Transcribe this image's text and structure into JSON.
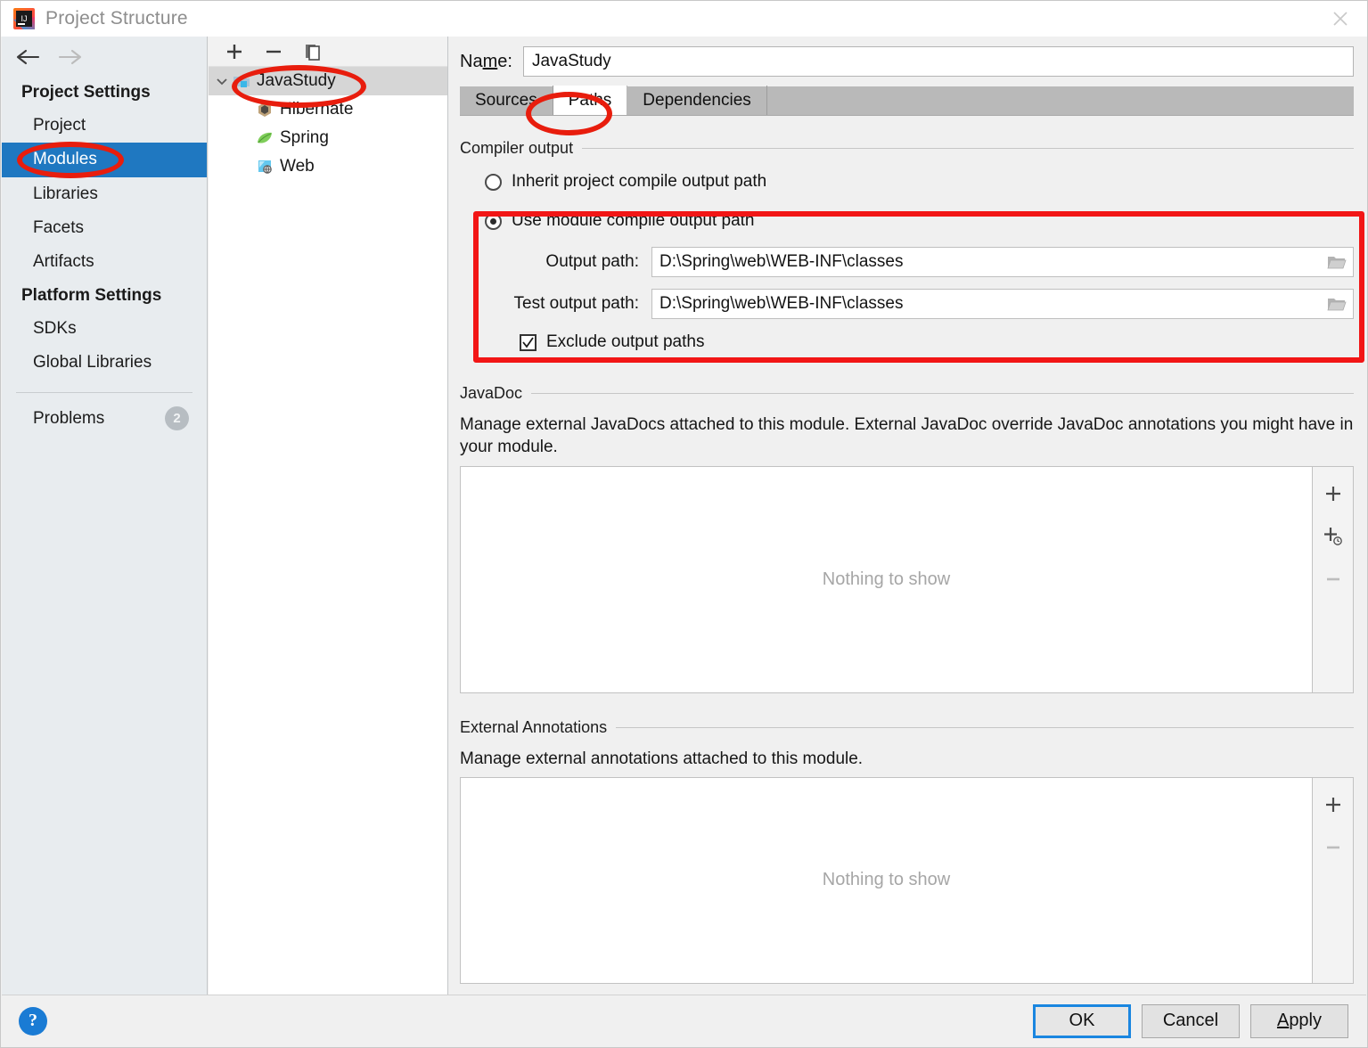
{
  "window": {
    "title": "Project Structure",
    "logo_icon": "intellij-idea-logo",
    "close_icon": "close-icon"
  },
  "sidebar": {
    "back_icon": "arrow-left-icon",
    "forward_icon": "arrow-right-icon",
    "groups": [
      {
        "header": "Project Settings",
        "items": [
          {
            "label": "Project",
            "selected": false
          },
          {
            "label": "Modules",
            "selected": true
          },
          {
            "label": "Libraries",
            "selected": false
          },
          {
            "label": "Facets",
            "selected": false
          },
          {
            "label": "Artifacts",
            "selected": false
          }
        ]
      },
      {
        "header": "Platform Settings",
        "items": [
          {
            "label": "SDKs",
            "selected": false
          },
          {
            "label": "Global Libraries",
            "selected": false
          }
        ]
      }
    ],
    "problems": {
      "label": "Problems",
      "count": "2"
    },
    "selected_color": "#1f78c1"
  },
  "tree": {
    "toolbar": {
      "add_icon": "plus-icon",
      "remove_icon": "minus-icon",
      "copy_icon": "copy-icon"
    },
    "nodes": [
      {
        "label": "JavaStudy",
        "icon": "module-folder-icon",
        "selected": true,
        "expanded": true,
        "depth": 0
      },
      {
        "label": "Hibernate",
        "icon": "hibernate-icon",
        "selected": false,
        "depth": 1
      },
      {
        "label": "Spring",
        "icon": "spring-leaf-icon",
        "selected": false,
        "depth": 1
      },
      {
        "label": "Web",
        "icon": "web-icon",
        "selected": false,
        "depth": 1
      }
    ]
  },
  "main": {
    "name_label_prefix": "Na",
    "name_label_mnemonic": "m",
    "name_label_suffix": "e:",
    "name_value": "JavaStudy",
    "tabs": [
      {
        "label": "Sources",
        "active": false
      },
      {
        "label": "Paths",
        "active": true
      },
      {
        "label": "Dependencies",
        "active": false
      }
    ],
    "compiler_output": {
      "group_title": "Compiler output",
      "inherit_option": "Inherit project compile output path",
      "inherit_selected": false,
      "module_option": "Use module compile output path",
      "module_selected": true,
      "output_path_label": "Output path:",
      "output_path_value": "D:\\Spring\\web\\WEB-INF\\classes",
      "test_output_path_label": "Test output path:",
      "test_output_path_value": "D:\\Spring\\web\\WEB-INF\\classes",
      "exclude_label": "Exclude output paths",
      "exclude_checked": true,
      "browse_icon": "folder-open-icon"
    },
    "javadoc": {
      "group_title": "JavaDoc",
      "description": "Manage external JavaDocs attached to this module. External JavaDoc override JavaDoc annotations you might have in your module.",
      "empty_text": "Nothing to show",
      "tools": [
        {
          "icon": "plus-icon",
          "name": "add-javadoc-button"
        },
        {
          "icon": "plus-url-icon",
          "name": "add-javadoc-url-button"
        },
        {
          "icon": "minus-icon",
          "name": "remove-javadoc-button"
        }
      ]
    },
    "external_annotations": {
      "group_title": "External Annotations",
      "description": "Manage external annotations attached to this module.",
      "empty_text": "Nothing to show",
      "tools": [
        {
          "icon": "plus-icon",
          "name": "add-annotation-button"
        },
        {
          "icon": "minus-icon",
          "name": "remove-annotation-button"
        }
      ]
    }
  },
  "footer": {
    "help_icon": "question-mark-icon",
    "ok_label": "OK",
    "cancel_label": "Cancel",
    "apply_mnemonic": "A",
    "apply_rest": "pply"
  },
  "annotations": {
    "color": "#ee1b0e",
    "shapes": [
      {
        "name": "highlight-ellipse-modules",
        "type": "ellipse"
      },
      {
        "name": "highlight-ellipse-javastudy",
        "type": "ellipse"
      },
      {
        "name": "highlight-ellipse-paths-tab",
        "type": "ellipse"
      },
      {
        "name": "highlight-rect-compiler-output",
        "type": "rect"
      }
    ]
  }
}
